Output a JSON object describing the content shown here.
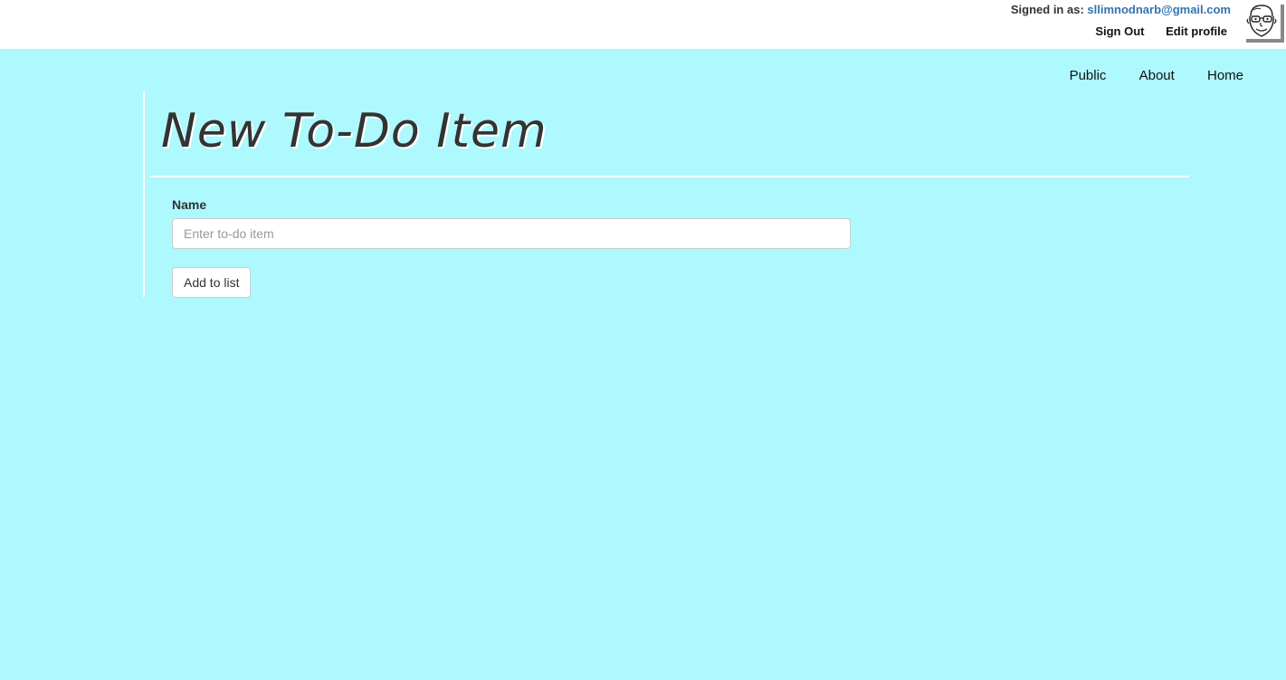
{
  "header": {
    "signed_in_prefix": "Signed in as:",
    "email": "sllimnodnarb@gmail.com",
    "sign_out_label": "Sign Out",
    "edit_profile_label": "Edit profile",
    "avatar_icon": "user-avatar-caricature"
  },
  "nav": {
    "items": [
      {
        "label": "Public"
      },
      {
        "label": "About"
      },
      {
        "label": "Home"
      }
    ]
  },
  "page": {
    "title": "New To-Do Item"
  },
  "form": {
    "name_label": "Name",
    "name_value": "",
    "name_placeholder": "Enter to-do item",
    "submit_label": "Add to list"
  },
  "colors": {
    "background": "#adf9fd",
    "link": "#3473b0",
    "title_text": "#333333"
  }
}
